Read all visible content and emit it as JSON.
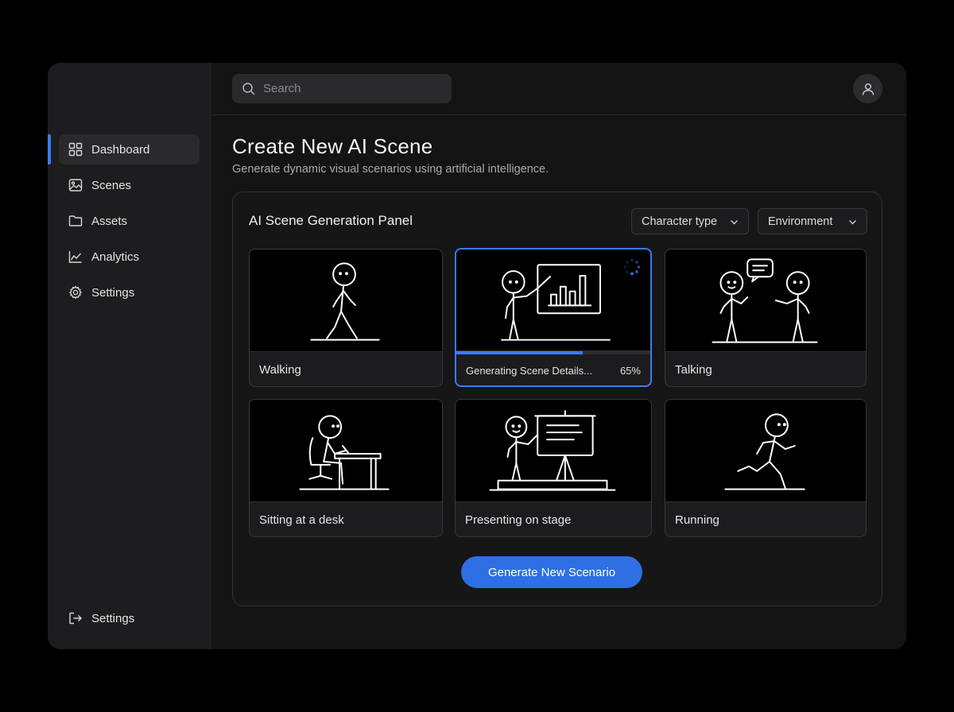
{
  "sidebar": {
    "items": [
      {
        "label": "Dashboard",
        "icon": "grid-icon",
        "active": true
      },
      {
        "label": "Scenes",
        "icon": "image-icon"
      },
      {
        "label": "Assets",
        "icon": "folder-icon"
      },
      {
        "label": "Analytics",
        "icon": "line-chart-icon"
      },
      {
        "label": "Settings",
        "icon": "gear-icon"
      }
    ],
    "bottom": {
      "label": "Settings",
      "icon": "logout-icon"
    }
  },
  "header": {
    "search_placeholder": "Search",
    "avatar_icon": "user-icon"
  },
  "main": {
    "title": "Create New AI Scene",
    "subtitle": "Generate dynamic visual scenarios using artificial intelligence."
  },
  "panel": {
    "title": "AI Scene Generation Panel",
    "filters": {
      "character_type": "Character type",
      "environment": "Environment"
    },
    "cards": [
      {
        "label": "Walking",
        "illustration": "stick-figure-walking"
      },
      {
        "label": "Generating Scene Details...",
        "illustration": "stick-figure-presenting-chart",
        "progress_percent": 65,
        "progress_label": "65%",
        "status": "generating",
        "spinner_icon": "loading-spinner-icon"
      },
      {
        "label": "Talking",
        "illustration": "two-stick-figures-talking"
      },
      {
        "label": "Sitting at a desk",
        "illustration": "stick-figure-sitting-desk"
      },
      {
        "label": "Presenting on stage",
        "illustration": "stick-figure-presenting-stage"
      },
      {
        "label": "Running",
        "illustration": "stick-figure-running"
      }
    ],
    "generate_button": "Generate New Scenario"
  },
  "colors": {
    "accent": "#3b7bf6",
    "button": "#2f6fe4",
    "background": "#141414",
    "sidebar": "#1d1d1f"
  }
}
